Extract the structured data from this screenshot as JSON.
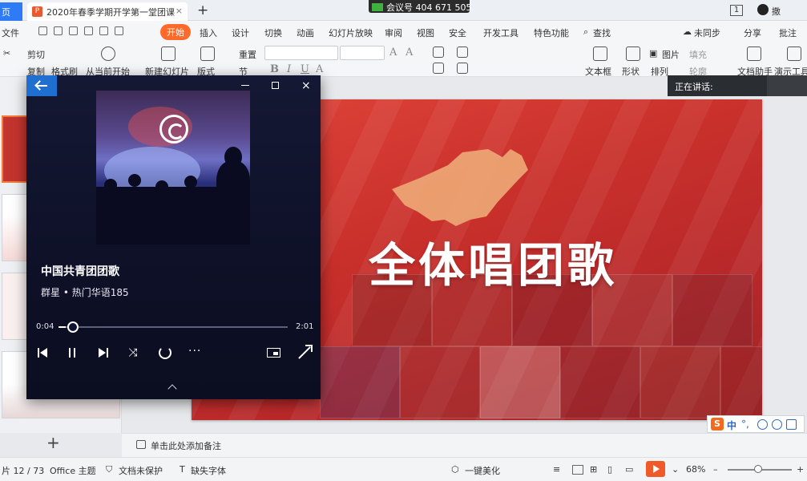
{
  "titlebar": {
    "home_tab": "页",
    "doc_tab": "2020年春季学期开学第一堂团课",
    "meeting": "会议号 404 671 505",
    "badge": "1",
    "user": "撒"
  },
  "menu": {
    "file": "文件",
    "start": "开始",
    "items": [
      "插入",
      "设计",
      "切换",
      "动画",
      "幻灯片放映",
      "审阅",
      "视图",
      "安全",
      "开发工具",
      "特色功能"
    ],
    "search": "查找",
    "sync": "未同步",
    "share": "分享",
    "comment": "批注"
  },
  "ribbon": {
    "cut": "剪切",
    "copy": "复制",
    "format_painter": "格式刷",
    "play_from_current": "从当前开始",
    "new_slide": "新建幻灯片",
    "layout": "版式",
    "reset": "重置",
    "section": "节",
    "text_box": "文本框",
    "shapes": "形状",
    "picture": "图片",
    "fill": "填充",
    "arrange": "排列",
    "outline": "轮廓",
    "doc_helper": "文档助手",
    "speaker_tools": "演示工具"
  },
  "speaker": {
    "label": "正在讲话:"
  },
  "slide": {
    "title": "全体唱团歌"
  },
  "notes": {
    "placeholder": "单击此处添加备注"
  },
  "status": {
    "slide_counter": "片 12 / 73",
    "theme": "Office 主题",
    "doc_protect": "文档未保护",
    "missing_font": "缺失字体",
    "beautify": "一键美化",
    "zoom": "68%"
  },
  "ime": {
    "lang": "中",
    "punct": "°,"
  },
  "player": {
    "song_title": "中国共青团团歌",
    "artist_album": "群星 • 热门华语185",
    "current_time": "0:04",
    "duration": "2:01",
    "progress": 0.033
  }
}
